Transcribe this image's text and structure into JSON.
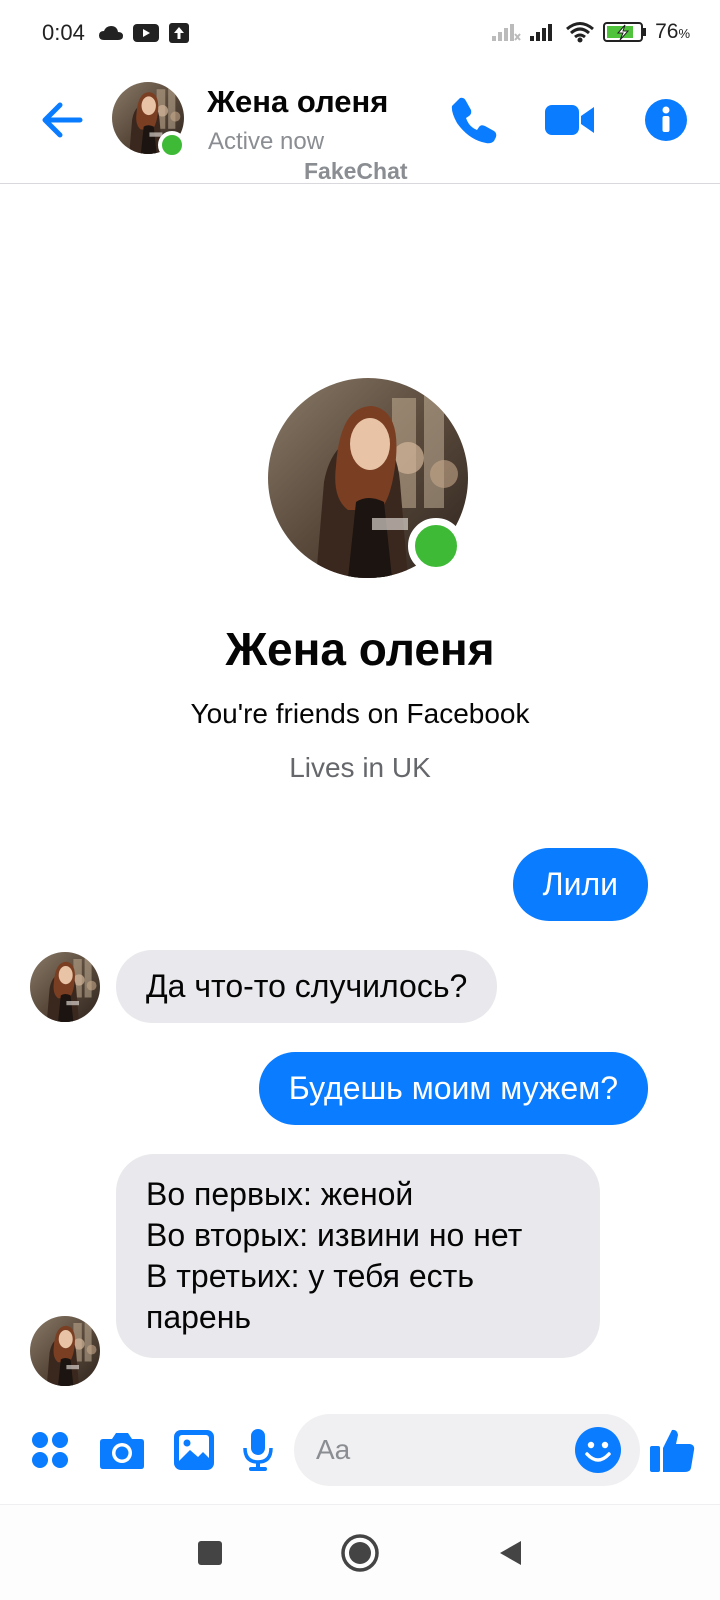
{
  "status_bar": {
    "time": "0:04",
    "battery_percent": "76",
    "battery_unit": "%"
  },
  "header": {
    "contact_name": "Жена оленя",
    "status": "Active now",
    "watermark": "FakeChat"
  },
  "profile": {
    "name": "Жена оленя",
    "friends_text": "You're friends on Facebook",
    "lives_text": "Lives in UK"
  },
  "messages": [
    {
      "direction": "outgoing",
      "text": "Лили"
    },
    {
      "direction": "incoming",
      "text": "Да что-то случилось?"
    },
    {
      "direction": "outgoing",
      "text": "Будешь моим мужем?"
    },
    {
      "direction": "incoming",
      "text": "Во первых: женой\nВо вторых: извини но нет\nВ третьих: у тебя есть\nпарень"
    }
  ],
  "composer": {
    "placeholder": "Aa"
  },
  "colors": {
    "accent": "#0a7cff",
    "online": "#3fba37",
    "incoming_bubble": "#e9e8ec"
  },
  "icons": [
    "back-arrow-icon",
    "phone-icon",
    "video-camera-icon",
    "info-icon",
    "apps-grid-icon",
    "camera-icon",
    "gallery-icon",
    "microphone-icon",
    "emoji-icon",
    "thumbs-up-icon",
    "nav-square-icon",
    "nav-home-icon",
    "nav-back-icon"
  ]
}
